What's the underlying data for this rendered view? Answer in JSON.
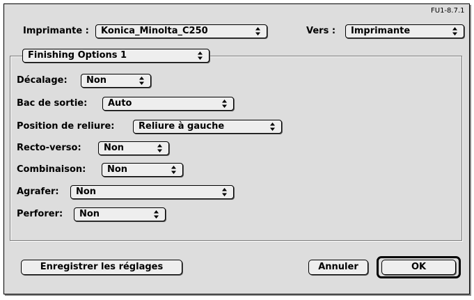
{
  "header": {
    "version": "FU1-8.7.1",
    "printer_label": "Imprimante :",
    "printer_value": "Konica_Minolta_C250",
    "destination_label": "Vers :",
    "destination_value": "Imprimante"
  },
  "panel": {
    "selected": "Finishing Options 1"
  },
  "options": {
    "offset": {
      "label": "Décalage:",
      "value": "Non"
    },
    "output_tray": {
      "label": "Bac de sortie:",
      "value": "Auto"
    },
    "binding_position": {
      "label": "Position de reliure:",
      "value": "Reliure à gauche"
    },
    "duplex": {
      "label": "Recto-verso:",
      "value": "Non"
    },
    "combination": {
      "label": "Combinaison:",
      "value": "Non"
    },
    "staple": {
      "label": "Agrafer:",
      "value": "Non"
    },
    "punch": {
      "label": "Perforer:",
      "value": "Non"
    }
  },
  "buttons": {
    "save_settings": "Enregistrer les réglages",
    "cancel": "Annuler",
    "ok": "OK"
  },
  "icons": {
    "popup_arrow": "up-down-arrows-icon"
  }
}
